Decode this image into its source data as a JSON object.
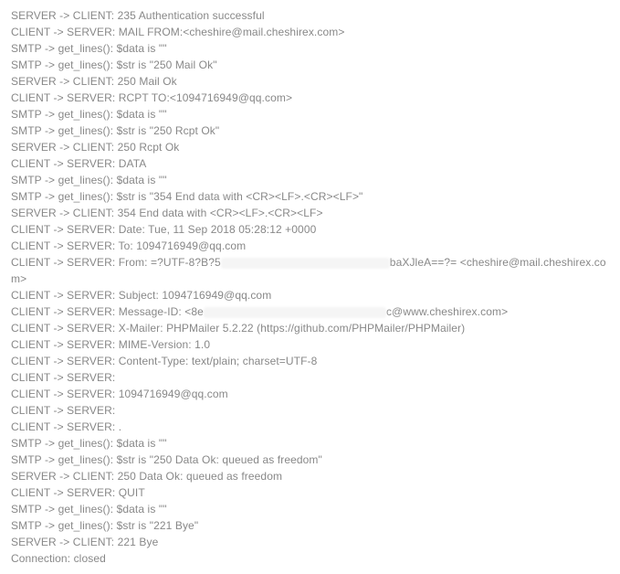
{
  "log": [
    "SERVER -> CLIENT: 235 Authentication successful",
    "CLIENT -> SERVER: MAIL FROM:<cheshire@mail.cheshirex.com>",
    "SMTP -> get_lines(): $data is \"\"",
    "SMTP -> get_lines(): $str is \"250 Mail Ok\"",
    "SERVER -> CLIENT: 250 Mail Ok",
    "CLIENT -> SERVER: RCPT TO:<1094716949@qq.com>",
    "SMTP -> get_lines(): $data is \"\"",
    "SMTP -> get_lines(): $str is \"250 Rcpt Ok\"",
    "SERVER -> CLIENT: 250 Rcpt Ok",
    "CLIENT -> SERVER: DATA",
    "SMTP -> get_lines(): $data is \"\"",
    "SMTP -> get_lines(): $str is \"354 End data with <CR><LF>.<CR><LF>\"",
    "SERVER -> CLIENT: 354 End data with <CR><LF>.<CR><LF>",
    "CLIENT -> SERVER: Date: Tue, 11 Sep 2018 05:28:12 +0000",
    "CLIENT -> SERVER: To: 1094716949@qq.com",
    "",
    "CLIENT -> SERVER: Subject: 1094716949@qq.com",
    "",
    "CLIENT -> SERVER: X-Mailer: PHPMailer 5.2.22 (https://github.com/PHPMailer/PHPMailer)",
    "CLIENT -> SERVER: MIME-Version: 1.0",
    "CLIENT -> SERVER: Content-Type: text/plain; charset=UTF-8",
    "CLIENT -> SERVER:",
    "CLIENT -> SERVER: 1094716949@qq.com",
    "CLIENT -> SERVER:",
    "CLIENT -> SERVER: .",
    "SMTP -> get_lines(): $data is \"\"",
    "SMTP -> get_lines(): $str is \"250 Data Ok: queued as freedom\"",
    "SERVER -> CLIENT: 250 Data Ok: queued as freedom",
    "CLIENT -> SERVER: QUIT",
    "SMTP -> get_lines(): $data is \"\"",
    "SMTP -> get_lines(): $str is \"221 Bye\"",
    "SERVER -> CLIENT: 221 Bye",
    "Connection: closed"
  ],
  "redacted_line_from": {
    "prefix": "CLIENT -> SERVER: From: =?UTF-8?B?5",
    "suffix": "baXJleA==?= <cheshire@mail.cheshirex.com>"
  },
  "redacted_line_msgid": {
    "prefix": "CLIENT -> SERVER: Message-ID: <8e",
    "suffix": "c@www.cheshirex.com>"
  }
}
